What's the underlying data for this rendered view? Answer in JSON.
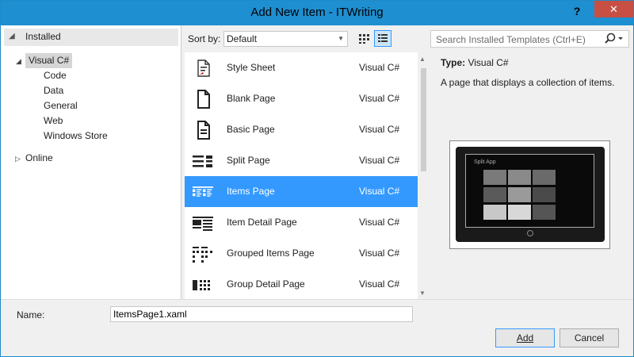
{
  "window": {
    "title": "Add New Item - ITWriting",
    "help_glyph": "?",
    "close_glyph": "✕"
  },
  "left_panel": {
    "installed_label": "Installed",
    "visual_csharp": "Visual C#",
    "children": [
      "Code",
      "Data",
      "General",
      "Web",
      "Windows Store"
    ],
    "online": "Online"
  },
  "toolbar": {
    "sort_label": "Sort by:",
    "sort_value": "Default"
  },
  "templates": [
    {
      "name": "Style Sheet",
      "lang": "Visual C#",
      "icon": "stylesheet-icon"
    },
    {
      "name": "Blank Page",
      "lang": "Visual C#",
      "icon": "blank-page-icon"
    },
    {
      "name": "Basic Page",
      "lang": "Visual C#",
      "icon": "basic-page-icon"
    },
    {
      "name": "Split Page",
      "lang": "Visual C#",
      "icon": "split-page-icon"
    },
    {
      "name": "Items Page",
      "lang": "Visual C#",
      "icon": "items-page-icon",
      "selected": true
    },
    {
      "name": "Item Detail Page",
      "lang": "Visual C#",
      "icon": "item-detail-page-icon"
    },
    {
      "name": "Grouped Items Page",
      "lang": "Visual C#",
      "icon": "grouped-items-page-icon"
    },
    {
      "name": "Group Detail Page",
      "lang": "Visual C#",
      "icon": "group-detail-page-icon"
    }
  ],
  "right_panel": {
    "search_placeholder": "Search Installed Templates (Ctrl+E)",
    "type_label": "Type:",
    "type_value": "Visual C#",
    "description": "A page that displays a collection of items.",
    "preview_app_title": "Split App"
  },
  "bottom": {
    "name_label": "Name:",
    "name_value": "ItemsPage1.xaml",
    "add_label": "Add",
    "cancel_label": "Cancel"
  },
  "colors": {
    "titlebar": "#1e8fd1",
    "selection": "#3399ff",
    "close_button": "#c74f44"
  }
}
